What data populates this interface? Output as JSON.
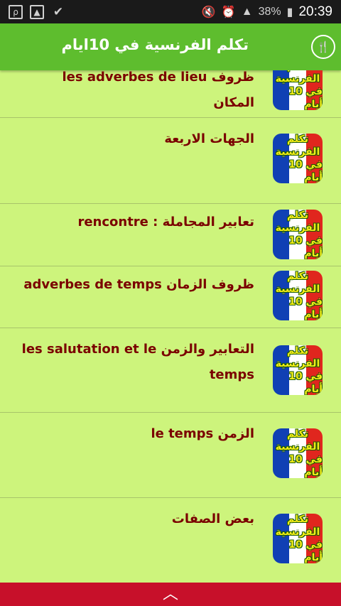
{
  "status_bar": {
    "icons_left": [
      "chat-app-icon",
      "gallery-icon",
      "check-icon"
    ],
    "icons_right": [
      "mute-icon",
      "alarm-icon",
      "signal-icon"
    ],
    "battery": "38%",
    "time": "20:39"
  },
  "app_bar": {
    "title": "تكلم الفرنسية في 10ايام"
  },
  "thumb": {
    "line1": "تكلم",
    "line2": "الفرنسية",
    "line3": "في 10 أيام"
  },
  "lessons": [
    {
      "title": "les adverbes de lieu ظروف المكان"
    },
    {
      "title": "الجهات الاربعة"
    },
    {
      "title": "rencontre : تعابير المجاملة"
    },
    {
      "title": "adverbes de temps ظروف الزمان"
    },
    {
      "title": "التعابير والزمن les salutation et le temps"
    },
    {
      "title": "الزمن le temps"
    },
    {
      "title": "بعض الصفات"
    }
  ],
  "colors": {
    "app_bar": "#5ebd2e",
    "list_bg": "#cdf47c",
    "text": "#7a0000",
    "bottom_bar": "#c7102a"
  },
  "bottom_bar": {
    "icon": "chevron-up-icon"
  }
}
